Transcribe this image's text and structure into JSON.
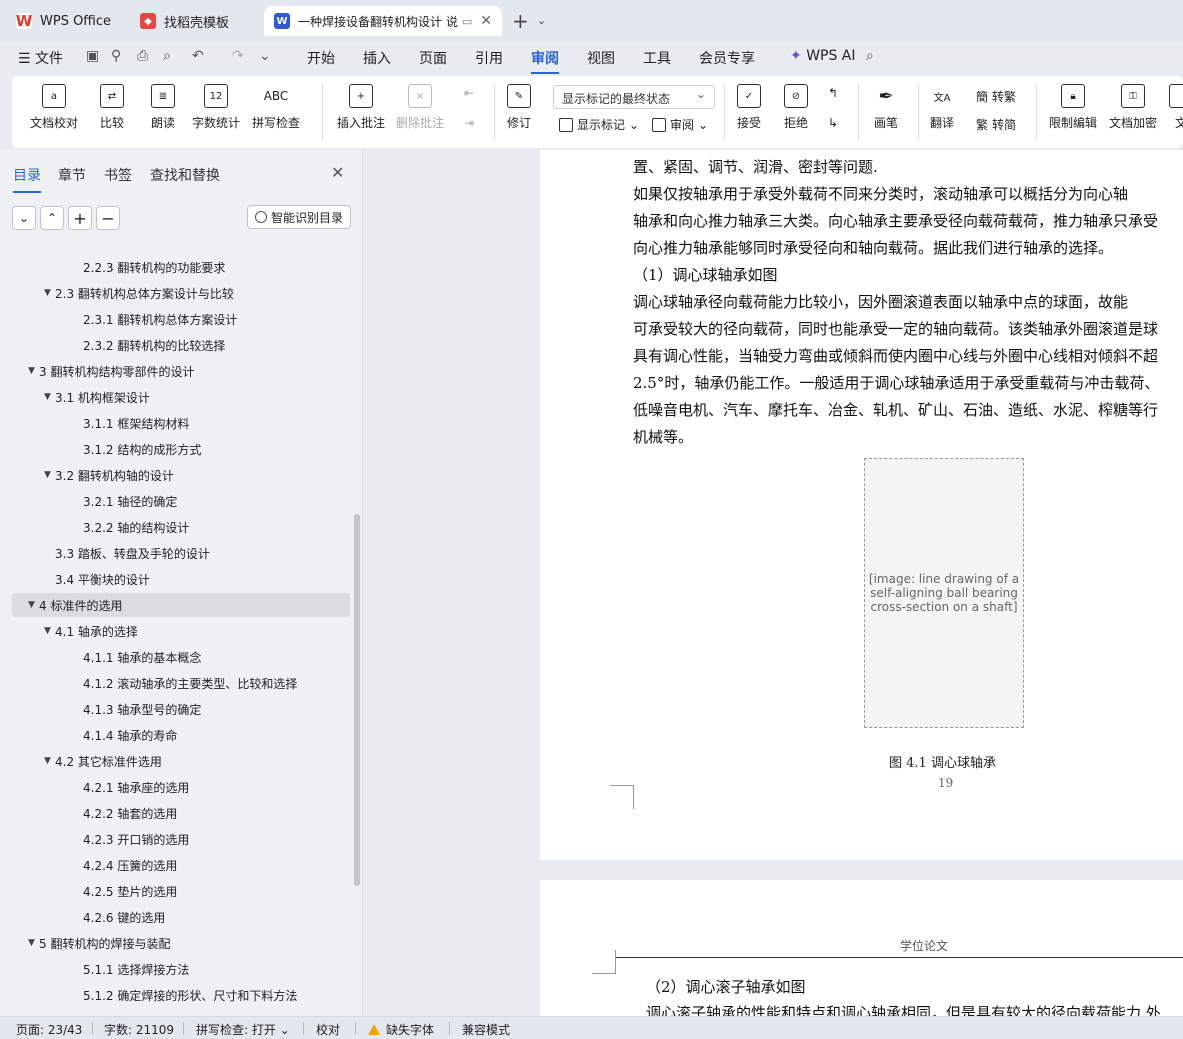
{
  "tabs": [
    {
      "label": "WPS Office",
      "icon": "wps-logo-icon"
    },
    {
      "label": "找稻壳模板",
      "icon": "docer-icon"
    },
    {
      "label": "一种焊接设备翻转机构设计 说",
      "icon": "word-doc-icon"
    }
  ],
  "menu": [
    "文件",
    "开始",
    "插入",
    "页面",
    "引用",
    "审阅",
    "视图",
    "工具",
    "会员专享",
    "WPS AI"
  ],
  "active_menu": "审阅",
  "ribbon": {
    "doc_check": "文档校对",
    "compare": "比较",
    "read_aloud": "朗读",
    "word_count": "字数统计",
    "word_count_icon_text": "12",
    "spell_check": "拼写检查",
    "spell_icon_text": "ABC",
    "insert_comment": "插入批注",
    "delete_comment": "删除批注",
    "revise": "修订",
    "markup_dropdown": "显示标记的最终状态",
    "show_markup": "显示标记",
    "review": "审阅",
    "accept": "接受",
    "reject": "拒绝",
    "ink": "画笔",
    "translate": "翻译",
    "to_traditional": "转繁",
    "to_simplified": "转简",
    "restrict_edit": "限制编辑",
    "encrypt": "文档加密",
    "more": "文"
  },
  "panel": {
    "tabs": [
      "目录",
      "章节",
      "书签",
      "查找和替换"
    ],
    "active_tab": "目录",
    "smart_button": "智能识别目录"
  },
  "toc": [
    {
      "text": "2.2.3  翻转机构的功能要求",
      "level": 3,
      "arrow": ""
    },
    {
      "text": "2.3  翻转机构总体方案设计与比较",
      "level": 2,
      "arrow": "▼"
    },
    {
      "text": "2.3.1  翻转机构总体方案设计",
      "level": 3,
      "arrow": ""
    },
    {
      "text": "2.3.2  翻转机构的比较选择",
      "level": 3,
      "arrow": ""
    },
    {
      "text": "3  翻转机构结构零部件的设计",
      "level": 1,
      "arrow": "▼"
    },
    {
      "text": "3.1  机构框架设计",
      "level": 2,
      "arrow": "▼"
    },
    {
      "text": "3.1.1  框架结构材料",
      "level": 3,
      "arrow": ""
    },
    {
      "text": "3.1.2  结构的成形方式",
      "level": 3,
      "arrow": ""
    },
    {
      "text": "3.2  翻转机构轴的设计",
      "level": 2,
      "arrow": "▼"
    },
    {
      "text": "3.2.1  轴径的确定",
      "level": 3,
      "arrow": ""
    },
    {
      "text": "3.2.2  轴的结构设计",
      "level": 3,
      "arrow": ""
    },
    {
      "text": "3.3  踏板、转盘及手轮的设计",
      "level": 2,
      "arrow": ""
    },
    {
      "text": "3.4  平衡块的设计",
      "level": 2,
      "arrow": ""
    },
    {
      "text": "4  标准件的选用",
      "level": 1,
      "arrow": "▼",
      "selected": true
    },
    {
      "text": "4.1  轴承的选择",
      "level": 2,
      "arrow": "▼"
    },
    {
      "text": "4.1.1  轴承的基本概念",
      "level": 3,
      "arrow": ""
    },
    {
      "text": "4.1.2  滚动轴承的主要类型、比较和选择",
      "level": 3,
      "arrow": ""
    },
    {
      "text": "4.1.3  轴承型号的确定",
      "level": 3,
      "arrow": ""
    },
    {
      "text": "4.1.4  轴承的寿命",
      "level": 3,
      "arrow": ""
    },
    {
      "text": "4.2  其它标准件选用",
      "level": 2,
      "arrow": "▼"
    },
    {
      "text": "4.2.1  轴承座的选用",
      "level": 3,
      "arrow": ""
    },
    {
      "text": "4.2.2  轴套的选用",
      "level": 3,
      "arrow": ""
    },
    {
      "text": "4.2.3  开口销的选用",
      "level": 3,
      "arrow": ""
    },
    {
      "text": "4.2.4  压簧的选用",
      "level": 3,
      "arrow": ""
    },
    {
      "text": "4.2.5  垫片的选用",
      "level": 3,
      "arrow": ""
    },
    {
      "text": "4.2.6  键的选用",
      "level": 3,
      "arrow": ""
    },
    {
      "text": "5  翻转机构的焊接与装配",
      "level": 1,
      "arrow": "▼"
    },
    {
      "text": "5.1.1  选择焊接方法",
      "level": 3,
      "arrow": ""
    },
    {
      "text": "5.1.2  确定焊接的形状、尺寸和下料方法",
      "level": 3,
      "arrow": ""
    }
  ],
  "document": {
    "page1_lines": [
      "置、紧固、调节、润滑、密封等问题.",
      "    如果仅按轴承用于承受外载荷不同来分类时，滚动轴承可以概括分为向心轴",
      "轴承和向心推力轴承三大类。向心轴承主要承受径向载荷载荷，推力轴承只承受",
      "向心推力轴承能够同时承受径向和轴向载荷。据此我们进行轴承的选择。",
      "    （1）调心球轴承如图",
      "    调心球轴承径向载荷能力比较小，因外圈滚道表面以轴承中点的球面，故能",
      "可承受较大的径向载荷，同时也能承受一定的轴向载荷。该类轴承外圈滚道是球",
      "具有调心性能，当轴受力弯曲或倾斜而使内圈中心线与外圈中心线相对倾斜不超",
      "2.5°时，轴承仍能工作。一般适用于调心球轴承适用于承受重载荷与冲击载荷、",
      "低噪音电机、汽车、摩托车、冶金、轧机、矿山、石油、造纸、水泥、榨糖等行",
      "机械等。"
    ],
    "figure_caption": "图 4.1 调心球轴承",
    "page_number": "19",
    "page2_header": "学位论文",
    "page2_lines": [
      "（2）调心滚子轴承如图",
      "调心滚子轴承的性能和特点和调心轴承相同，但是具有较大的径向载荷能力 外"
    ]
  },
  "status": {
    "page": "页面: 23/43",
    "words": "字数: 21109",
    "spell": "拼写检查: 打开",
    "proof": "校对",
    "missing_font": "缺失字体",
    "compat": "兼容模式"
  },
  "colors": {
    "accent": "#2b62d9",
    "wps_red": "#e23b2e",
    "docer_red": "#e8483f",
    "word_blue": "#2d5bd3"
  }
}
